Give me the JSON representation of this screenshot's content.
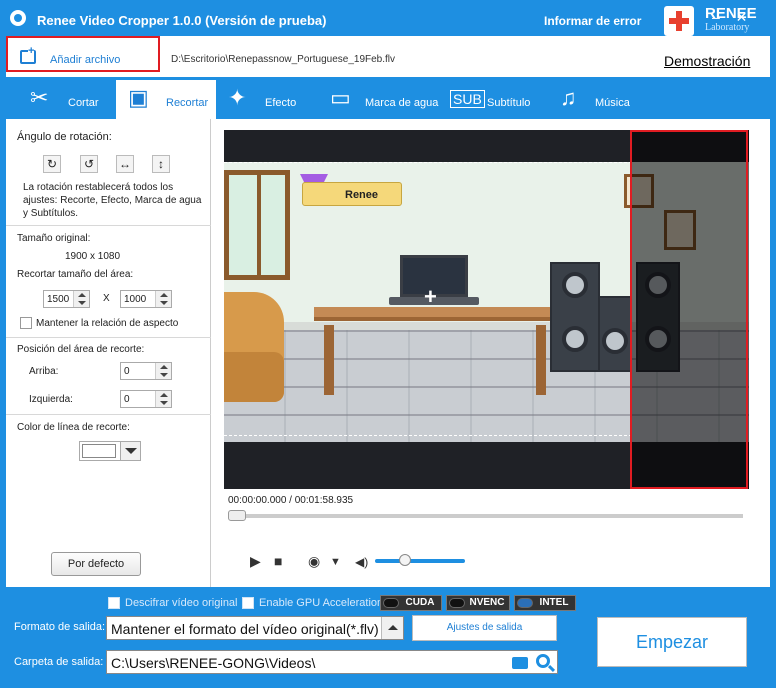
{
  "window": {
    "title": "Renee Video Cropper 1.0.0 (Versión de prueba)",
    "report_error": "Informar de error",
    "logo_text": "RENEE",
    "logo_sub": "Laboratory",
    "controls": "– ✕"
  },
  "file": {
    "add_label": "Añadir archivo",
    "path": "D:\\Escritorio\\Renepassnow_Portuguese_19Feb.flv",
    "demo_link": "Demostración"
  },
  "tabs": [
    {
      "label": "Cortar",
      "icon": "scissors-icon",
      "active": false
    },
    {
      "label": "Recortar",
      "icon": "crop-icon",
      "active": true
    },
    {
      "label": "Efecto",
      "icon": "magic-wand-icon",
      "active": false
    },
    {
      "label": "Marca de agua",
      "icon": "watermark-icon",
      "active": false
    },
    {
      "label": "Subtítulo",
      "icon": "subtitle-icon",
      "active": false
    },
    {
      "label": "Música",
      "icon": "music-icon",
      "active": false
    }
  ],
  "crop_panel": {
    "rotation_title": "Ángulo de rotación:",
    "rotation_note": "La rotación restablecerá todos los ajustes: Recorte, Efecto, Marca de agua y Subtítulos.",
    "original_size_label": "Tamaño original:",
    "original_size_value": "1900 x 1080",
    "crop_area_label": "Recortar tamaño del área:",
    "crop_width": "1500",
    "crop_x": "X",
    "crop_height": "1000",
    "keep_ratio": "Mantener la relación de aspecto",
    "position_title": "Posición del área de recorte:",
    "top_label": "Arriba:",
    "top_value": "0",
    "left_label": "Izquierda:",
    "left_value": "0",
    "line_color_label": "Color de línea de recorte:",
    "default_button": "Por defecto"
  },
  "player": {
    "time": "00:00:00.000 / 00:01:58.935",
    "badge_text": "Renee",
    "progress": 0,
    "volume": 0.3
  },
  "output": {
    "decrypt": "Descifrar vídeo original",
    "gpu": "Enable GPU Acceleration",
    "hw": [
      "CUDA",
      "NVENC",
      "INTEL"
    ],
    "format_label": "Formato de salida:",
    "format_value": "Mantener el formato del vídeo original(*.flv)",
    "settings_button": "Ajustes de salida",
    "folder_label": "Carpeta de salida:",
    "folder_value": "C:\\Users\\RENEE-GONG\\Videos\\",
    "start_button": "Empezar"
  },
  "colors": {
    "accent": "#1e8fe1",
    "highlight": "#e01c22"
  }
}
